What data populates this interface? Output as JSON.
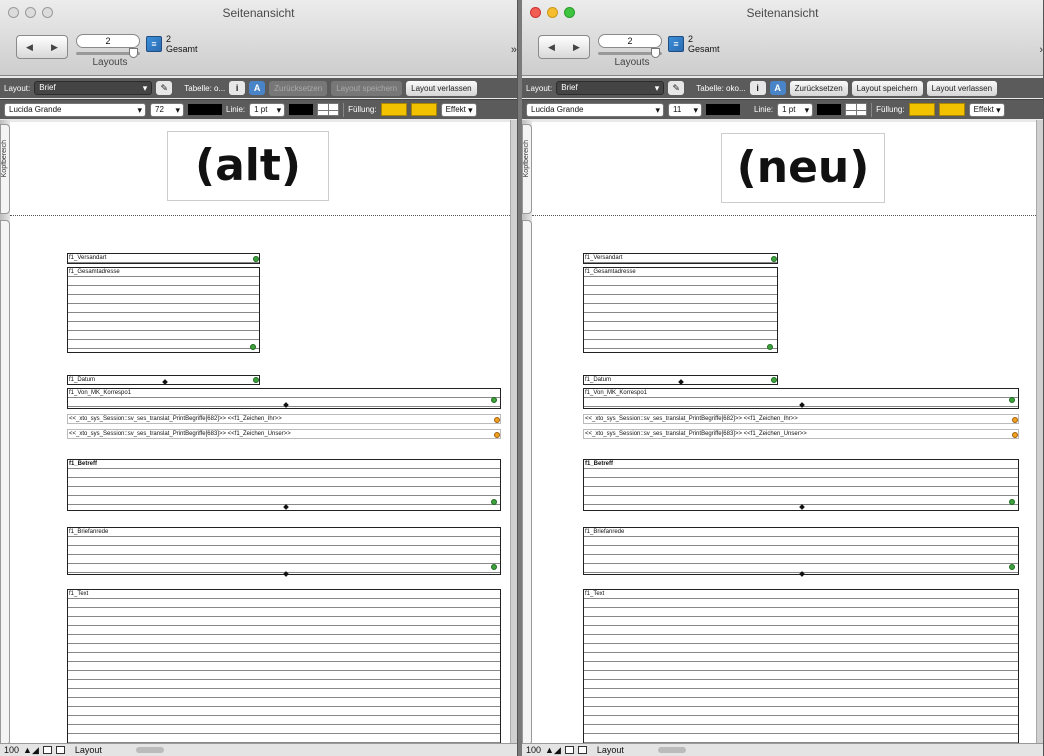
{
  "windows": [
    {
      "id": "left",
      "active": false,
      "title": "Seitenansicht",
      "page_number": "2",
      "total_count": "2",
      "total_label": "Gesamt",
      "layouts_label": "Layouts",
      "layout_label": "Layout:",
      "layout_value": "Brief",
      "table_label": "Tabelle: o...",
      "reset_button": "Zurücksetzen",
      "reset_enabled": false,
      "save_button": "Layout speichern",
      "save_enabled": false,
      "exit_button": "Layout verlassen",
      "font": "Lucida Grande",
      "font_size": "72",
      "line_label": "Linie:",
      "line_value": "1 pt",
      "fill_label": "Füllung:",
      "effect_label": "Effekt",
      "header_tab": "Kopfbereich",
      "header_text": "(alt)",
      "zoom": "100",
      "mode": "Layout"
    },
    {
      "id": "right",
      "active": true,
      "title": "Seitenansicht",
      "page_number": "2",
      "total_count": "2",
      "total_label": "Gesamt",
      "layouts_label": "Layouts",
      "layout_label": "Layout:",
      "layout_value": "Brief",
      "table_label": "Tabelle: oko...",
      "reset_button": "Zurücksetzen",
      "reset_enabled": true,
      "save_button": "Layout speichern",
      "save_enabled": true,
      "exit_button": "Layout verlassen",
      "font": "Lucida Grande",
      "font_size": "11",
      "line_label": "Linie:",
      "line_value": "1 pt",
      "fill_label": "Füllung:",
      "effect_label": "Effekt",
      "header_tab": "Kopfbereich",
      "header_text": "(neu)",
      "zoom": "100",
      "mode": "Layout"
    }
  ],
  "fields": {
    "versandart": "f1_Versandart",
    "gesamtadresse": "f1_Gesamtadresse",
    "datum": "f1_Datum",
    "von_mk": "f1_Von_MK_Korrespo1",
    "zeichen_ihr": "<<_xto_sys_Session::sv_ses_translat_PrintBegriffe[682]>> <<f1_Zeichen_Ihr>>",
    "zeichen_unser": "<<_xto_sys_Session::sv_ses_translat_PrintBegriffe[683]>> <<f1_Zeichen_Unser>>",
    "betreff": "f1_Betreff",
    "briefanrede": "f1_Briefanrede",
    "text": "f1_Text"
  },
  "colors": {
    "fill_swatch": "#f2c100",
    "traffic_red": "#f25d55",
    "traffic_yellow": "#f6bd2f",
    "traffic_green": "#3ec43f"
  }
}
